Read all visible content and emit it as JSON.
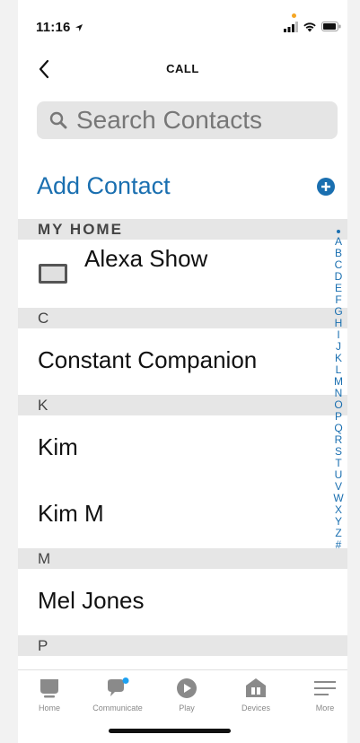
{
  "status_bar": {
    "time": "11:16"
  },
  "nav": {
    "title": "CALL"
  },
  "search": {
    "placeholder": "Search Contacts"
  },
  "add_contact": {
    "label": "Add Contact"
  },
  "sections": {
    "my_home": {
      "header": "MY HOME",
      "device_name": "Alexa Show"
    },
    "c": {
      "header": "C",
      "contact": "Constant Companion"
    },
    "k": {
      "header": "K",
      "contacts": [
        "Kim",
        "Kim M"
      ]
    },
    "m": {
      "header": "M",
      "contact": "Mel Jones"
    },
    "p": {
      "header": "P"
    }
  },
  "alpha_index": [
    "A",
    "B",
    "C",
    "D",
    "E",
    "F",
    "G",
    "H",
    "I",
    "J",
    "K",
    "L",
    "M",
    "N",
    "O",
    "P",
    "Q",
    "R",
    "S",
    "T",
    "U",
    "V",
    "W",
    "X",
    "Y",
    "Z",
    "#"
  ],
  "tabs": [
    {
      "label": "Home",
      "icon": "home-icon"
    },
    {
      "label": "Communicate",
      "icon": "communicate-icon"
    },
    {
      "label": "Play",
      "icon": "play-icon"
    },
    {
      "label": "Devices",
      "icon": "devices-icon"
    },
    {
      "label": "More",
      "icon": "more-icon"
    }
  ],
  "colors": {
    "accent": "#1a6fb0",
    "notification_dot": "#1da1f2",
    "section_bg": "#e6e6e6",
    "search_bg": "#e5e5e5"
  }
}
